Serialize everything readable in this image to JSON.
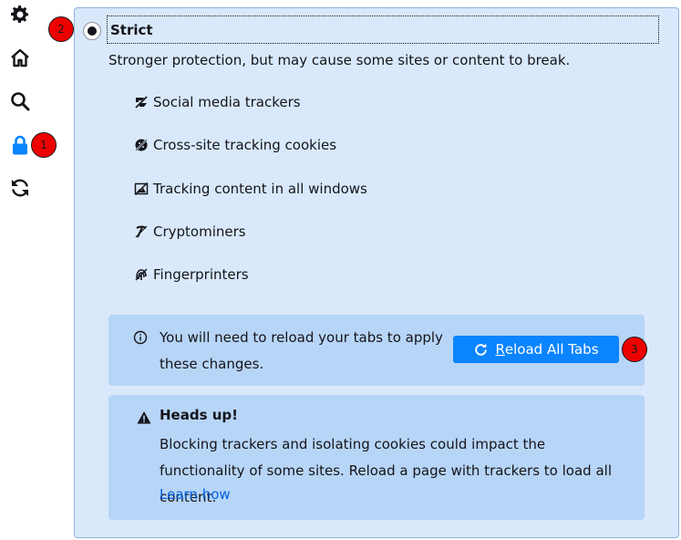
{
  "sidebar": {
    "items": [
      {
        "icon": "gear-icon",
        "name": "General"
      },
      {
        "icon": "home-icon",
        "name": "Home"
      },
      {
        "icon": "search-icon",
        "name": "Search"
      },
      {
        "icon": "lock-icon",
        "name": "Privacy & Security",
        "selected": true,
        "color": "#0a84ff"
      },
      {
        "icon": "sync-icon",
        "name": "Sync"
      }
    ]
  },
  "badges": [
    "1",
    "2",
    "3"
  ],
  "strict": {
    "label": "Strict",
    "selected": true,
    "description": "Stronger protection, but may cause some sites or content to break.",
    "features": [
      {
        "icon": "social-tracker-icon",
        "label": "Social media trackers"
      },
      {
        "icon": "cookie-icon",
        "label": "Cross-site tracking cookies"
      },
      {
        "icon": "tracking-content-icon",
        "label": "Tracking content in all windows"
      },
      {
        "icon": "cryptominer-icon",
        "label": "Cryptominers"
      },
      {
        "icon": "fingerprinter-icon",
        "label": "Fingerprinters"
      }
    ]
  },
  "reload": {
    "message": "You will need to reload your tabs to apply these changes.",
    "button_access_key": "R",
    "button_rest": "eload All Tabs"
  },
  "warning": {
    "title": "Heads up!",
    "body": "Blocking trackers and isolating cookies could impact the functionality of some sites. Reload a page with trackers to load all content.",
    "link": "Learn how"
  },
  "colors": {
    "accent": "#0a84ff",
    "panel_bg": "#d9e9fb",
    "box_bg": "#b7d5f7",
    "badge": "#ee0000",
    "link": "#0060df"
  }
}
